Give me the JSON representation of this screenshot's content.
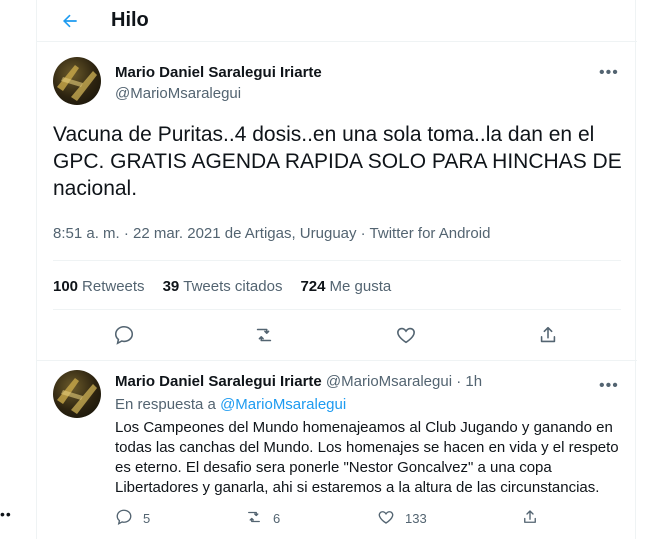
{
  "header": {
    "title": "Hilo"
  },
  "main_tweet": {
    "author_name": "Mario Daniel Saralegui Iriarte",
    "author_handle": "@MarioMsaralegui",
    "text": "Vacuna de Puritas..4 dosis..en una sola toma..la dan en el GPC. GRATIS AGENDA RAPIDA SOLO PARA HINCHAS DE nacional.",
    "meta": "8:51 a. m. · 22 mar. 2021 de Artigas, Uruguay · Twitter for Android",
    "stats": {
      "retweets_count": "100",
      "retweets_label": "Retweets",
      "quotes_count": "39",
      "quotes_label": "Tweets citados",
      "likes_count": "724",
      "likes_label": "Me gusta"
    }
  },
  "reply_tweet": {
    "author_name": "Mario Daniel Saralegui Iriarte",
    "author_handle": "@MarioMsaralegui",
    "time": "· 1h",
    "reply_prefix": "En respuesta a",
    "reply_handle": "@MarioMsaralegui",
    "text": "Los Campeones del Mundo homenajeamos al Club Jugando y ganando en todas las canchas del Mundo. Los homenajes se hacen en vida y el respeto es eterno. El desafio sera ponerle \"Nestor Goncalvez\" a una copa Libertadores y ganarla, ahi si estaremos a la altura de las circunstancias.",
    "replies": "5",
    "retweets": "6",
    "likes": "133"
  },
  "icons": {
    "back": "arrow-left-icon",
    "more": "more-horizontal-icon",
    "reply": "comment-icon",
    "retweet": "retweet-icon",
    "like": "heart-icon",
    "share": "share-icon"
  },
  "colors": {
    "accent": "#1d9bf0",
    "secondary_text": "#536471",
    "border": "#eff3f4"
  }
}
